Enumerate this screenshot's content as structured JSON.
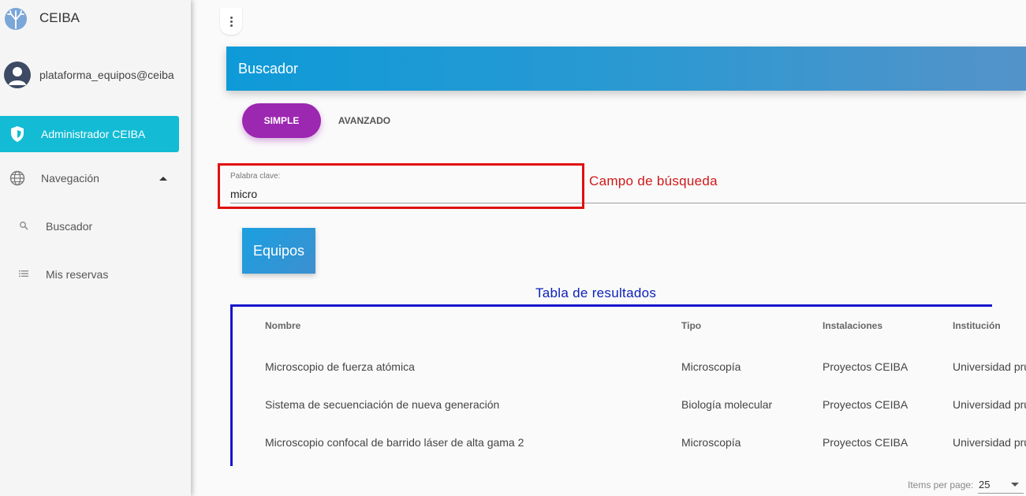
{
  "brand": {
    "title": "CEIBA"
  },
  "user": {
    "email": "plataforma_equipos@ceiba"
  },
  "sidebar": {
    "active_item": {
      "label": "Administrador CEIBA"
    },
    "navigation": {
      "label": "Navegación"
    },
    "sub_items": [
      {
        "label": "Buscador",
        "icon": "search-icon"
      },
      {
        "label": "Mis reservas",
        "icon": "list-icon"
      }
    ]
  },
  "header": {
    "title": "Buscador"
  },
  "tabs": {
    "simple": "SIMPLE",
    "advanced": "AVANZADO"
  },
  "search": {
    "label": "Palabra clave:",
    "value": "micro"
  },
  "annotations": {
    "search_field": "Campo de búsqueda",
    "results_table": "Tabla de resultados"
  },
  "results": {
    "section_button": "Equipos"
  },
  "table": {
    "headers": [
      "Nombre",
      "Tipo",
      "Instalaciones",
      "Institución"
    ],
    "rows": [
      [
        "Microscopio de fuerza atómica",
        "Microscopía",
        "Proyectos CEIBA",
        "Universidad prue"
      ],
      [
        "Sistema de secuenciación de nueva generación",
        "Biología molecular",
        "Proyectos CEIBA",
        "Universidad prue"
      ],
      [
        "Microscopio confocal de barrido láser de alta gama 2",
        "Microscopía",
        "Proyectos CEIBA",
        "Universidad prue"
      ]
    ]
  },
  "pagination": {
    "label": "Items per page:",
    "value": "25"
  },
  "colors": {
    "accent_cyan": "#13bcd4",
    "tab_purple": "#9c27b0",
    "header_blue": "#0e9ad8",
    "annotation_red": "#e01010",
    "annotation_blue": "#1515cc"
  }
}
